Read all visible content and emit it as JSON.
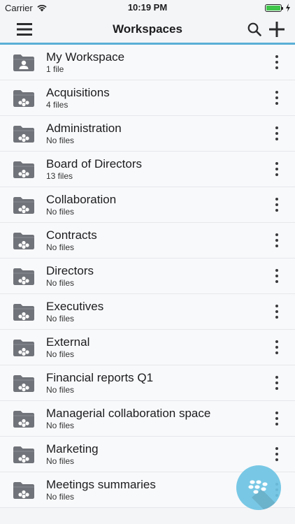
{
  "status_bar": {
    "carrier": "Carrier",
    "time": "10:19 PM",
    "battery_level": 1.0
  },
  "header": {
    "title": "Workspaces",
    "menu_icon": "hamburger-icon",
    "search_icon": "search-icon",
    "add_icon": "plus-icon"
  },
  "workspaces": [
    {
      "name": "My Workspace",
      "count": "1 file",
      "icon": "personal-folder-icon"
    },
    {
      "name": "Acquisitions",
      "count": "4 files",
      "icon": "shared-folder-icon"
    },
    {
      "name": "Administration",
      "count": "No files",
      "icon": "shared-folder-icon"
    },
    {
      "name": "Board of Directors",
      "count": "13 files",
      "icon": "shared-folder-icon"
    },
    {
      "name": "Collaboration",
      "count": "No files",
      "icon": "shared-folder-icon"
    },
    {
      "name": "Contracts",
      "count": "No files",
      "icon": "shared-folder-icon"
    },
    {
      "name": "Directors",
      "count": "No files",
      "icon": "shared-folder-icon"
    },
    {
      "name": "Executives",
      "count": "No files",
      "icon": "shared-folder-icon"
    },
    {
      "name": "External",
      "count": "No files",
      "icon": "shared-folder-icon"
    },
    {
      "name": "Financial reports Q1",
      "count": "No files",
      "icon": "shared-folder-icon"
    },
    {
      "name": "Managerial collaboration space",
      "count": "No files",
      "icon": "shared-folder-icon"
    },
    {
      "name": "Marketing",
      "count": "No files",
      "icon": "shared-folder-icon"
    },
    {
      "name": "Meetings summaries",
      "count": "No files",
      "icon": "shared-folder-icon"
    }
  ],
  "colors": {
    "accent": "#5aafd6",
    "fab": "#6ec4e4",
    "folder": "#707379"
  }
}
